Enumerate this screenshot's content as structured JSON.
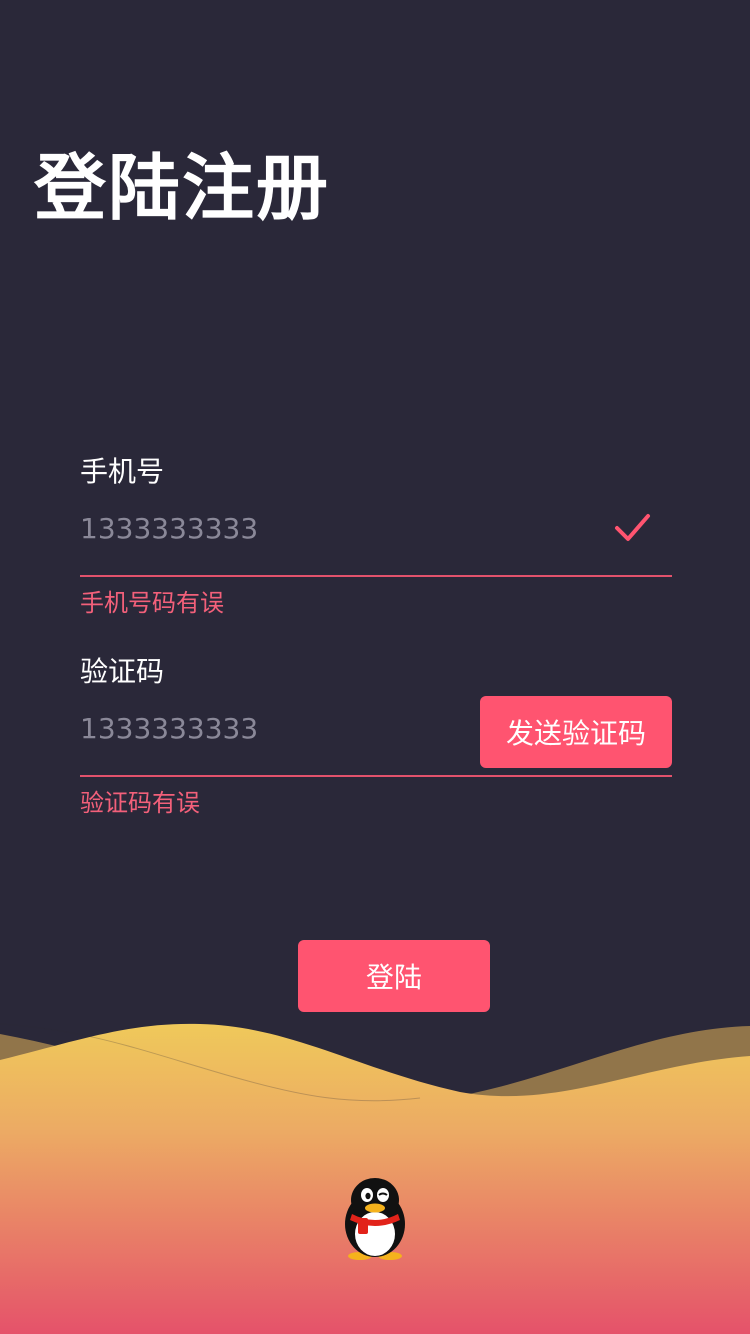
{
  "page": {
    "title": "登陆注册"
  },
  "form": {
    "phone": {
      "label": "手机号",
      "value": "1333333333",
      "error": "手机号码有误",
      "valid_icon": "checkmark-icon"
    },
    "code": {
      "label": "验证码",
      "value": "1333333333",
      "error": "验证码有误",
      "send_button_label": "发送验证码"
    },
    "login_button_label": "登陆"
  },
  "footer": {
    "logo_icon": "qq-penguin-icon"
  },
  "colors": {
    "background": "#2a2839",
    "accent": "#ff5470",
    "error_text": "#f3607a",
    "wave_top": "#efc95a",
    "wave_bottom": "#e5526a"
  }
}
